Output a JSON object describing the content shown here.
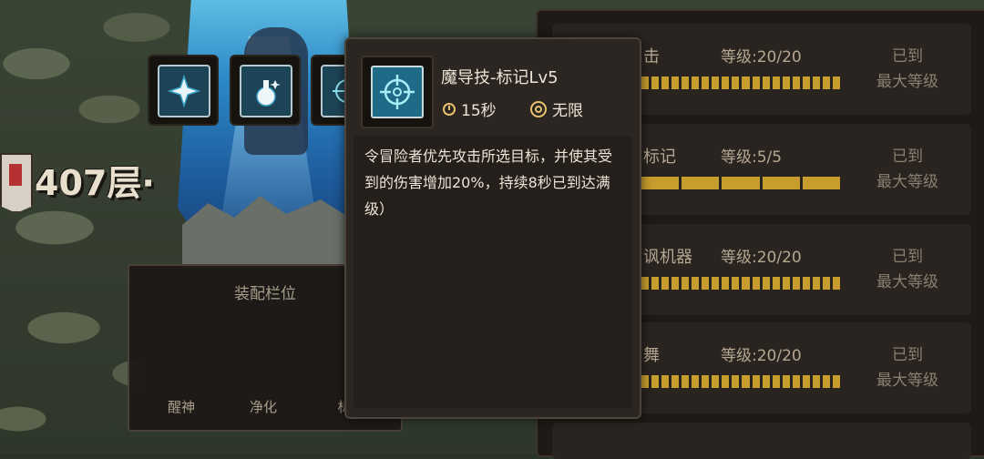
{
  "scene": {
    "floor_label": "407层·"
  },
  "equip": {
    "title": "装配栏位",
    "slots": [
      {
        "label": "醒神",
        "icon": "sparkle-skill-icon"
      },
      {
        "label": "净化",
        "icon": "potion-skill-icon"
      },
      {
        "label": "标",
        "icon": "crosshair-skill-icon"
      }
    ]
  },
  "skills": [
    {
      "name": "击",
      "level": "等级:20/20",
      "status_line1": "已到",
      "status_line2": "最大等级",
      "progress": 1.0,
      "segments": 20
    },
    {
      "name": "标记",
      "level": "等级:5/5",
      "status_line1": "已到",
      "status_line2": "最大等级",
      "progress": 1.0,
      "segments": 5
    },
    {
      "name": "讽机器",
      "level": "等级:20/20",
      "status_line1": "已到",
      "status_line2": "最大等级",
      "progress": 1.0,
      "segments": 20
    },
    {
      "name": "舞",
      "level": "等级:20/20",
      "status_line1": "已到",
      "status_line2": "最大等级",
      "progress": 1.0,
      "segments": 20
    }
  ],
  "tooltip": {
    "title": "魔导技-标记Lv5",
    "cooldown": "15秒",
    "range": "无限",
    "description": "令冒险者优先攻击所选目标，并使其受到的伤害增加20%，持续8秒已到达满级）",
    "icon": "crosshair-skill-icon"
  },
  "colors": {
    "accent_gold": "#c79e2e",
    "panel_bg": "#1e1a16",
    "text_light": "#ece4d4",
    "text_muted": "#b5a791"
  }
}
